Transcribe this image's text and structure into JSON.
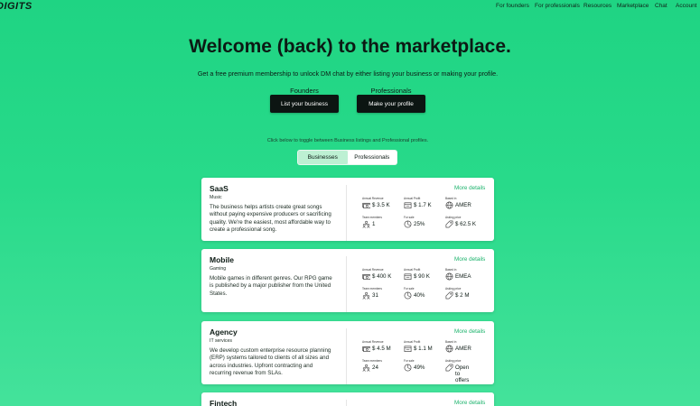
{
  "nav": {
    "logo": "DIGITS",
    "items": [
      "For founders",
      "For professionals",
      "Resources",
      "Marketplace",
      "Chat",
      "Account"
    ]
  },
  "hero": {
    "title": "Welcome (back) to the marketplace.",
    "subtitle": "Get a free premium membership to unlock DM chat by either listing your business or making your profile.",
    "founders_label": "Founders",
    "professionals_label": "Professionals",
    "founders_cta": "List your business",
    "professionals_cta": "Make your profile"
  },
  "toggle": {
    "hint": "Click below to toggle between Business listings and Professional profiles.",
    "options": [
      "Businesses",
      "Professionals"
    ]
  },
  "metric_labels": {
    "revenue": "Annual Revenue",
    "profit": "Annual Profit",
    "based": "Based in",
    "team": "Team members",
    "sale": "For sale",
    "price": "Asking price"
  },
  "more_label": "More details",
  "listings": [
    {
      "name": "SaaS",
      "category": "Music",
      "description": "The business helps artists create great songs without paying expensive producers or sacrificing quality. We're the easiest, most affordable way to create a professional song.",
      "revenue": "$ 3.5 K",
      "profit": "$ 1.7 K",
      "based": "AMER",
      "team": "1",
      "sale": "25%",
      "price": "$ 62.5 K"
    },
    {
      "name": "Mobile",
      "category": "Gaming",
      "description": "Mobile games in different genres. Our RPG game is published by a major publisher from the United States.",
      "revenue": "$ 400 K",
      "profit": "$ 90 K",
      "based": "EMEA",
      "team": "31",
      "sale": "40%",
      "price": "$ 2 M"
    },
    {
      "name": "Agency",
      "category": "IT services",
      "description": "We develop custom enterprise resource planning (ERP) systems tailored to clients of all sizes and across industries. Upfront contracting and recurring revenue from SLAs.",
      "revenue": "$ 4.5 M",
      "profit": "$ 1.1 M",
      "based": "AMER",
      "team": "24",
      "sale": "49%",
      "price": "Open to offers"
    },
    {
      "name": "Fintech",
      "category": "",
      "description": "",
      "revenue": "",
      "profit": "",
      "based": "",
      "team": "",
      "sale": "",
      "price": ""
    }
  ],
  "colors": {
    "background": "#28da8a",
    "accent": "#1cb36c",
    "button": "#0c1512",
    "card": "#ffffff"
  }
}
